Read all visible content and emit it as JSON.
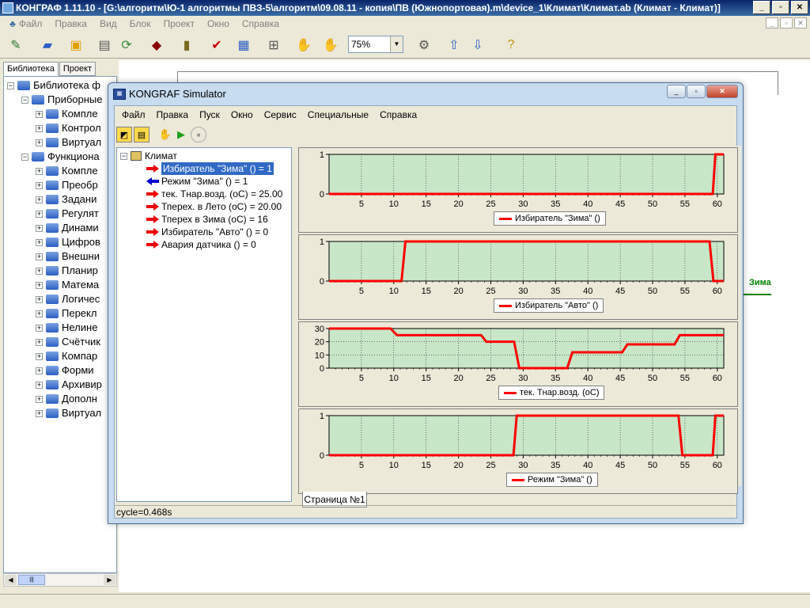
{
  "app": {
    "title": "КОНГРАФ 1.11.10 - [G:\\алгоритм\\Ю-1 алгоритмы ПВЗ-5\\алгоритм\\09.08.11 - копия\\ПВ (Южнопортовая).m\\device_1\\Климат\\Климат.ab (Климат - Климат)]",
    "menu": [
      "Файл",
      "Правка",
      "Вид",
      "Блок",
      "Проект",
      "Окно",
      "Справка"
    ],
    "zoom": "75%"
  },
  "library": {
    "tabs": [
      "Библиотека",
      "Проект"
    ],
    "tree": [
      {
        "label": "Библиотека ф",
        "level": 0,
        "sign": "−"
      },
      {
        "label": "Приборные",
        "level": 1,
        "sign": "−"
      },
      {
        "label": "Компле",
        "level": 2,
        "sign": "+"
      },
      {
        "label": "Контрол",
        "level": 2,
        "sign": "+"
      },
      {
        "label": "Виртуал",
        "level": 2,
        "sign": "+"
      },
      {
        "label": "Функциона",
        "level": 1,
        "sign": "−"
      },
      {
        "label": "Компле",
        "level": 2,
        "sign": "+"
      },
      {
        "label": "Преобр",
        "level": 2,
        "sign": "+"
      },
      {
        "label": "Задани",
        "level": 2,
        "sign": "+"
      },
      {
        "label": "Регулят",
        "level": 2,
        "sign": "+"
      },
      {
        "label": "Динами",
        "level": 2,
        "sign": "+"
      },
      {
        "label": "Цифров",
        "level": 2,
        "sign": "+"
      },
      {
        "label": "Внешни",
        "level": 2,
        "sign": "+"
      },
      {
        "label": "Планир",
        "level": 2,
        "sign": "+"
      },
      {
        "label": "Матема",
        "level": 2,
        "sign": "+"
      },
      {
        "label": "Логичес",
        "level": 2,
        "sign": "+"
      },
      {
        "label": "Перекл",
        "level": 2,
        "sign": "+"
      },
      {
        "label": "Нелине",
        "level": 2,
        "sign": "+"
      },
      {
        "label": "Счётчик",
        "level": 2,
        "sign": "+"
      },
      {
        "label": "Компар",
        "level": 2,
        "sign": "+"
      },
      {
        "label": "Форми",
        "level": 2,
        "sign": "+"
      },
      {
        "label": "Архивир",
        "level": 2,
        "sign": "+"
      },
      {
        "label": "Дополн",
        "level": 2,
        "sign": "+"
      },
      {
        "label": "Виртуал",
        "level": 2,
        "sign": "+"
      }
    ]
  },
  "doc": {
    "zima_label": "Зима"
  },
  "simulator": {
    "title": "KONGRAF Simulator",
    "menu": [
      "Файл",
      "Правка",
      "Пуск",
      "Окно",
      "Сервис",
      "Специальные",
      "Справка"
    ],
    "tree_root": "Климат",
    "signals": [
      {
        "label": "Избиратель \"Зима\" () = 1",
        "dir": "out",
        "selected": true
      },
      {
        "label": "Режим \"Зима\" () = 1",
        "dir": "in",
        "selected": false
      },
      {
        "label": "тек. Тнар.возд. (оС) = 25.00",
        "dir": "out",
        "selected": false
      },
      {
        "label": "Тперех. в Лето (оС) = 20.00",
        "dir": "out",
        "selected": false
      },
      {
        "label": "Тперех в Зима (оС) = 16",
        "dir": "out",
        "selected": false
      },
      {
        "label": "Избиратель \"Авто\" () = 0",
        "dir": "out",
        "selected": false
      },
      {
        "label": "Авария датчика () = 0",
        "dir": "out",
        "selected": false
      }
    ],
    "page_tab": "Страница №1",
    "status": "cycle=0.468s"
  },
  "chart_data": [
    {
      "type": "line",
      "series": [
        {
          "name": "Избиратель \"Зима\" ()",
          "x": [
            0,
            59.3,
            59.7,
            61
          ],
          "values": [
            0,
            0,
            1,
            1
          ]
        }
      ],
      "xlim": [
        0,
        61
      ],
      "xticks": [
        5,
        10,
        15,
        20,
        25,
        30,
        35,
        40,
        45,
        50,
        55,
        60
      ],
      "ylim": [
        0,
        1
      ],
      "yticks": [
        0,
        1
      ],
      "grid": true,
      "colors": {
        "plot_bg": "#c8e6c8",
        "line": "#ff0000",
        "grid": "#000000"
      }
    },
    {
      "type": "line",
      "series": [
        {
          "name": "Избиратель \"Авто\" ()",
          "x": [
            0,
            11.2,
            11.8,
            58.8,
            59.4,
            61
          ],
          "values": [
            0,
            0,
            1,
            1,
            0,
            0
          ]
        }
      ],
      "xlim": [
        0,
        61
      ],
      "xticks": [
        5,
        10,
        15,
        20,
        25,
        30,
        35,
        40,
        45,
        50,
        55,
        60
      ],
      "ylim": [
        0,
        1
      ],
      "yticks": [
        0,
        1
      ],
      "grid": true,
      "colors": {
        "plot_bg": "#c8e6c8",
        "line": "#ff0000",
        "grid": "#000000"
      }
    },
    {
      "type": "line",
      "series": [
        {
          "name": "тек. Тнар.возд. (оС)",
          "x": [
            0,
            9.5,
            10.5,
            23.5,
            24.3,
            28.6,
            29.4,
            36.8,
            37.6,
            45.3,
            46.1,
            53.4,
            54.2,
            61
          ],
          "values": [
            30,
            30,
            25,
            25,
            20,
            20,
            0,
            0,
            12,
            12,
            18,
            18,
            25,
            25
          ]
        }
      ],
      "xlim": [
        0,
        61
      ],
      "xticks": [
        5,
        10,
        15,
        20,
        25,
        30,
        35,
        40,
        45,
        50,
        55,
        60
      ],
      "ylim": [
        0,
        30
      ],
      "yticks": [
        0,
        10,
        20,
        30
      ],
      "grid": true,
      "colors": {
        "plot_bg": "#c8e6c8",
        "line": "#ff0000",
        "grid": "#000000"
      }
    },
    {
      "type": "line",
      "series": [
        {
          "name": "Режим \"Зима\" ()",
          "x": [
            0,
            28.5,
            29,
            54,
            54.6,
            59.3,
            59.7,
            61
          ],
          "values": [
            0,
            0,
            1,
            1,
            0,
            0,
            1,
            1
          ]
        }
      ],
      "xlim": [
        0,
        61
      ],
      "xticks": [
        5,
        10,
        15,
        20,
        25,
        30,
        35,
        40,
        45,
        50,
        55,
        60
      ],
      "ylim": [
        0,
        1
      ],
      "yticks": [
        0,
        1
      ],
      "grid": true,
      "colors": {
        "plot_bg": "#c8e6c8",
        "line": "#ff0000",
        "grid": "#000000"
      }
    }
  ]
}
